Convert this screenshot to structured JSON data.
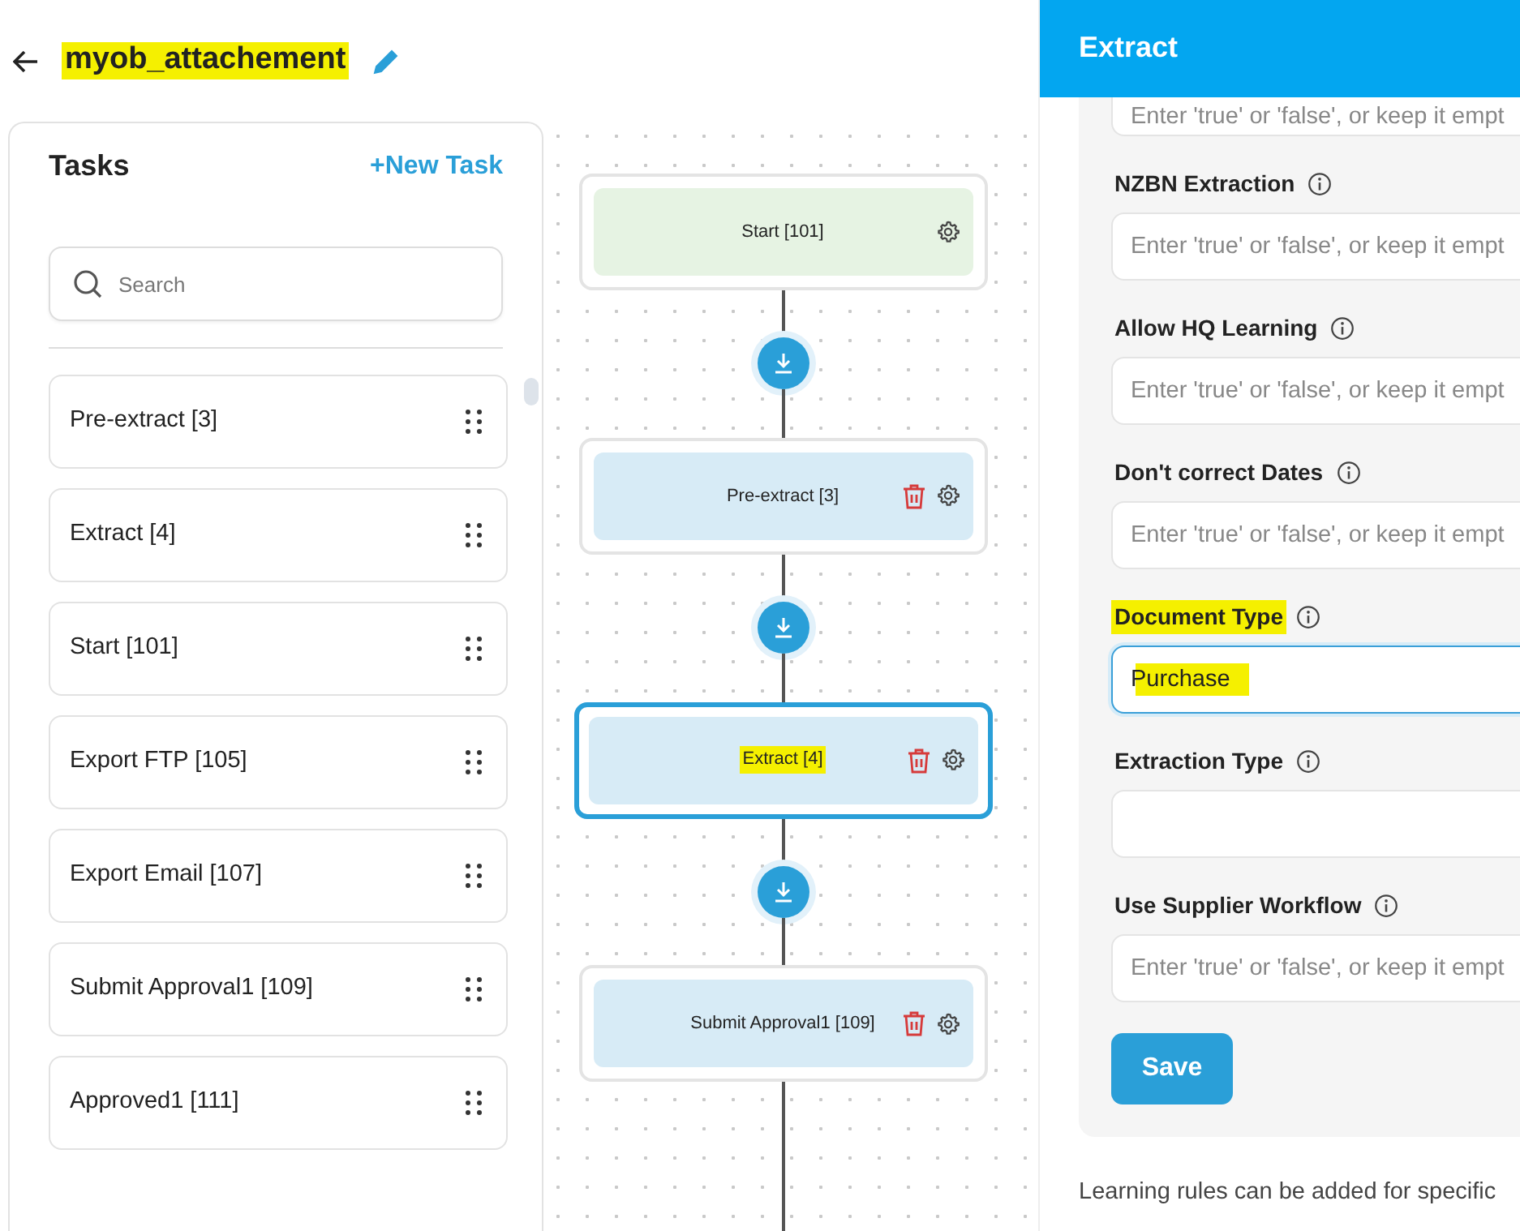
{
  "header": {
    "title": "myob_attachement",
    "title_highlighted": true
  },
  "tasks_panel": {
    "title": "Tasks",
    "new_task_button": {
      "icon": "+",
      "label": "New Task"
    },
    "search": {
      "placeholder": "Search"
    },
    "items": [
      {
        "label": "Pre-extract [3]"
      },
      {
        "label": "Extract [4]"
      },
      {
        "label": "Start [101]"
      },
      {
        "label": "Export FTP [105]"
      },
      {
        "label": "Export Email [107]"
      },
      {
        "label": "Submit Approval1 [109]"
      },
      {
        "label": "Approved1 [111]"
      }
    ]
  },
  "flow": {
    "nodes": [
      {
        "label": "Start [101]",
        "kind": "start",
        "selected": false,
        "highlighted": false
      },
      {
        "label": "Pre-extract [3]",
        "kind": "task",
        "selected": false,
        "highlighted": false
      },
      {
        "label": "Extract [4]",
        "kind": "task",
        "selected": true,
        "highlighted": true
      },
      {
        "label": "Submit Approval1 [109]",
        "kind": "task",
        "selected": false,
        "highlighted": false
      }
    ]
  },
  "side_panel": {
    "title": "Extract",
    "fields": [
      {
        "placeholder": "Enter 'true' or 'false', or keep it empt",
        "focused": false,
        "value_highlighted": false
      },
      {
        "label": "NZBN Extraction",
        "placeholder": "Enter 'true' or 'false', or keep it empt",
        "focused": false,
        "label_highlighted": false,
        "value_highlighted": false
      },
      {
        "label": "Allow HQ Learning",
        "placeholder": "Enter 'true' or 'false', or keep it empt",
        "focused": false,
        "label_highlighted": false,
        "value_highlighted": false
      },
      {
        "label": "Don't correct Dates",
        "placeholder": "Enter 'true' or 'false', or keep it empt",
        "focused": false,
        "label_highlighted": false,
        "value_highlighted": false
      },
      {
        "label": "Document Type",
        "value": "Purchase",
        "focused": true,
        "label_highlighted": true,
        "value_highlighted": true
      },
      {
        "label": "Extraction Type",
        "focused": false,
        "label_highlighted": false,
        "value_highlighted": false
      },
      {
        "label": "Use Supplier Workflow",
        "placeholder": "Enter 'true' or 'false', or keep it empt",
        "focused": false,
        "label_highlighted": false,
        "value_highlighted": false
      }
    ],
    "save_button": "Save",
    "footer_text": "Learning rules can be added for specific"
  }
}
